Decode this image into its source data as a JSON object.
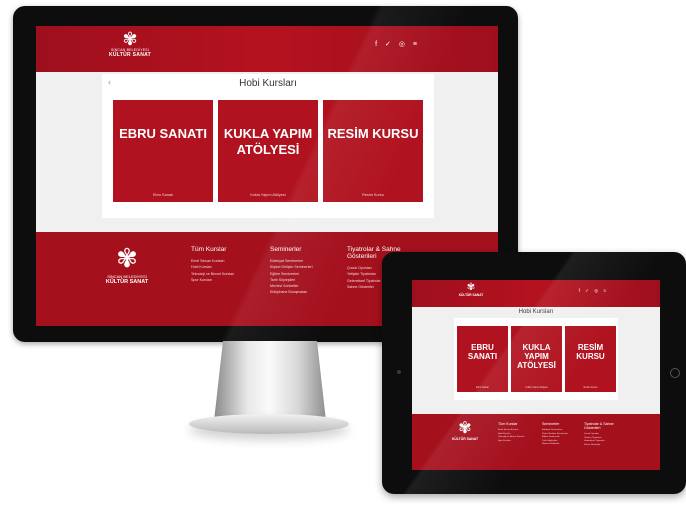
{
  "brand": {
    "logo_line1": "SİNCAN BELEDİYESİ",
    "logo_line2": "KÜLTÜR SANAT",
    "logo_glyph": "✾",
    "accent_color": "#b0131f"
  },
  "header": {
    "social_icons": "f ✓ ◎ ≡"
  },
  "page": {
    "back_icon": "‹",
    "title": "Hobi Kursları"
  },
  "cards": [
    {
      "title": "EBRU SANATI",
      "caption": "Ebru Sanatı"
    },
    {
      "title": "KUKLA YAPIM ATÖLYESİ",
      "caption": "Kukla Yapım Atölyesi"
    },
    {
      "title": "RESİM KURSU",
      "caption": "Resim Kursu"
    }
  ],
  "footer": {
    "columns": [
      {
        "heading": "Tüm Kurslar",
        "items": [
          "Emel Sincan Kursları",
          "Hobi Kursları",
          "Teknoloji ve Beceri Kursları",
          "Spor Kursları"
        ]
      },
      {
        "heading": "Seminerler",
        "items": [
          "Edebiyat Seminerleri",
          "Kişisel Gelişim Seminerleri",
          "Eğitim Seminerleri",
          "Tarih Söyleşileri",
          "Mevlevi Sohbetler",
          "Kütüphane Buluşmaları"
        ]
      },
      {
        "heading": "Tiyatrolar & Sahne Gösterileri",
        "items": [
          "Çocuk Oyunları",
          "Yetişkin Tiyatroları",
          "Geleneksel Tiyatrolar",
          "Sahne Gösteriler"
        ]
      }
    ]
  }
}
